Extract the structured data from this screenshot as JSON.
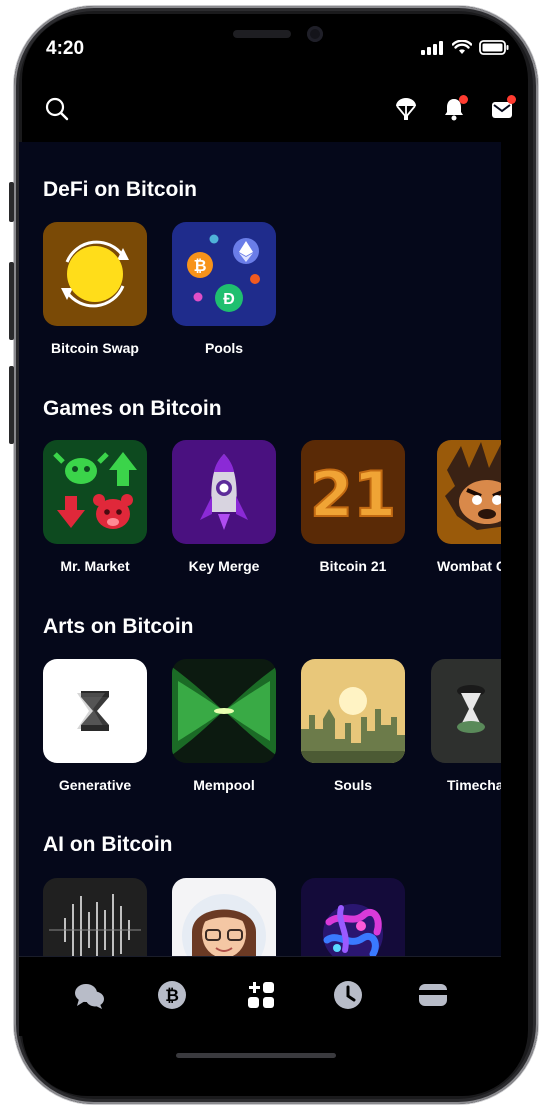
{
  "status_bar": {
    "time": "4:20"
  },
  "header": {
    "icons": [
      "search-icon",
      "parachute-icon",
      "bell-icon",
      "mail-icon"
    ]
  },
  "sections": [
    {
      "title": "DeFi on Bitcoin",
      "apps": [
        {
          "label": "Bitcoin Swap",
          "icon": "swap-icon"
        },
        {
          "label": "Pools",
          "icon": "pools-icon"
        }
      ]
    },
    {
      "title": "Games on Bitcoin",
      "apps": [
        {
          "label": "Mr. Market",
          "icon": "bull-bear-icon"
        },
        {
          "label": "Key Merge",
          "icon": "rocket-icon"
        },
        {
          "label": "Bitcoin 21",
          "icon": "number-21-icon"
        },
        {
          "label": "Wombat C",
          "icon": "wombat-icon"
        }
      ]
    },
    {
      "title": "Arts on Bitcoin",
      "apps": [
        {
          "label": "Generative",
          "icon": "hourglass-icon"
        },
        {
          "label": "Mempool",
          "icon": "mempool-art-icon"
        },
        {
          "label": "Souls",
          "icon": "city-sunset-icon"
        },
        {
          "label": "Timecha",
          "icon": "timechain-icon"
        }
      ]
    },
    {
      "title": "AI on Bitcoin",
      "apps": [
        {
          "label": "",
          "icon": "waveform-icon"
        },
        {
          "label": "",
          "icon": "avatar-portrait-icon"
        },
        {
          "label": "",
          "icon": "neural-sphere-icon"
        }
      ]
    }
  ],
  "bottom_nav": [
    "chat-icon",
    "bitcoin-icon",
    "apps-icon",
    "clock-icon",
    "wallet-icon"
  ],
  "colors": {
    "background": "#05081a",
    "accent_red": "#ff3b30"
  }
}
